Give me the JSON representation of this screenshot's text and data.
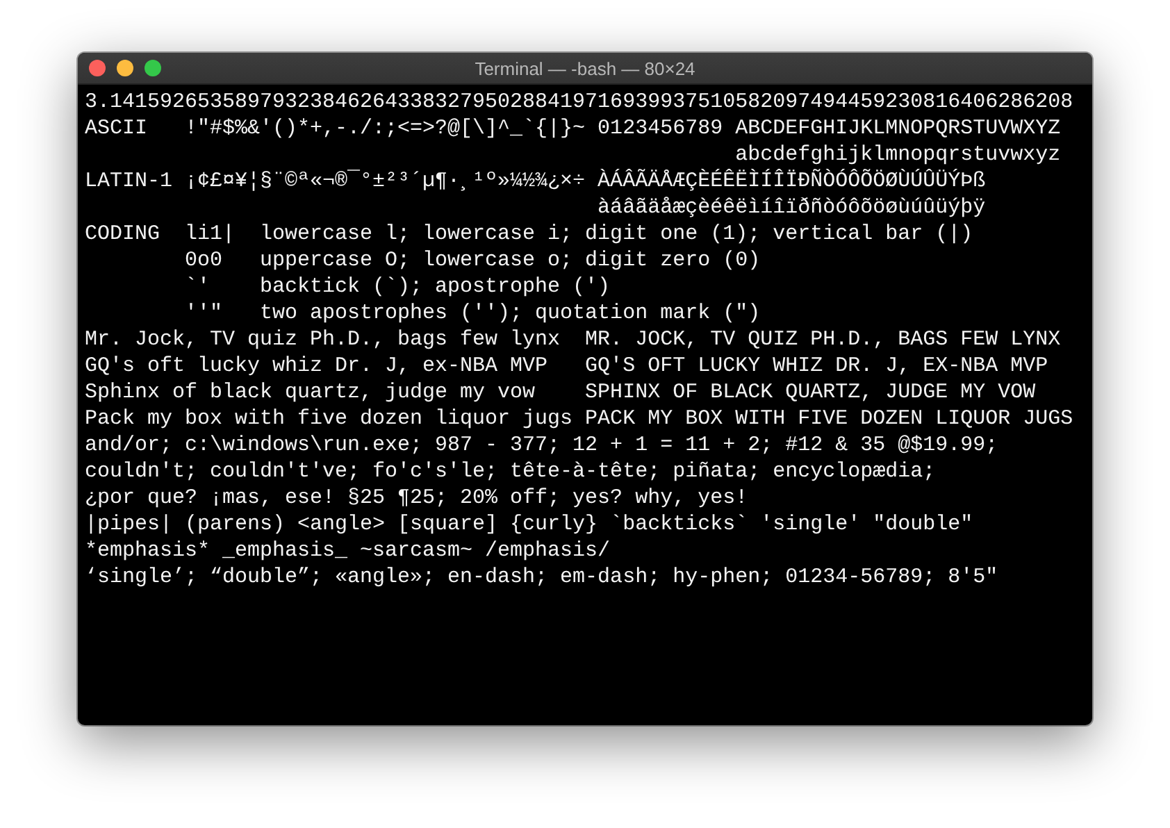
{
  "window": {
    "title": "Terminal — -bash — 80×24",
    "buttons": [
      {
        "color": "#fc605c"
      },
      {
        "color": "#fdbc40"
      },
      {
        "color": "#34c84a"
      }
    ]
  },
  "terminal": {
    "lines": [
      "3.14159265358979323846264338327950288419716939937510582097494459230816406286208",
      "ASCII   !\"#$%&'()*+,-./:;<=>?@[\\]^_`{|}~ 0123456789 ABCDEFGHIJKLMNOPQRSTUVWXYZ",
      "                                                    abcdefghijklmnopqrstuvwxyz",
      "LATIN-1 ¡¢£¤¥¦§¨©ª«¬®¯°±²³´µ¶·¸¹º»¼½¾¿×÷ ÀÁÂÃÄÅÆÇÈÉÊËÌÍÎÏÐÑÒÓÔÕÖØÙÚÛÜÝÞß",
      "                                         àáâãäåæçèéêëìíîïðñòóôõöøùúûüýþÿ",
      "CODING  li1|  lowercase l; lowercase i; digit one (1); vertical bar (|)",
      "        0o0   uppercase O; lowercase o; digit zero (0)",
      "        `'    backtick (`); apostrophe (')",
      "        ''\"   two apostrophes (''); quotation mark (\")",
      "Mr. Jock, TV quiz Ph.D., bags few lynx  MR. JOCK, TV QUIZ PH.D., BAGS FEW LYNX",
      "GQ's oft lucky whiz Dr. J, ex-NBA MVP   GQ'S OFT LUCKY WHIZ DR. J, EX-NBA MVP",
      "Sphinx of black quartz, judge my vow    SPHINX OF BLACK QUARTZ, JUDGE MY VOW",
      "Pack my box with five dozen liquor jugs PACK MY BOX WITH FIVE DOZEN LIQUOR JUGS",
      "and/or; c:\\windows\\run.exe; 987 - 377; 12 + 1 = 11 + 2; #12 & 35 @$19.99;",
      "couldn't; couldn't've; fo'c's'le; tête-à-tête; piñata; encyclopædia;",
      "¿por que? ¡mas, ese! §25 ¶25; 20% off; yes? why, yes!",
      "|pipes| (parens) <angle> [square] {curly} `backticks` 'single' \"double\"",
      "*emphasis* _emphasis_ ~sarcasm~ /emphasis/",
      "‘single’; “double”; «angle»; en-dash; em-dash; hy-phen; 01234-56789; 8′5″"
    ]
  }
}
